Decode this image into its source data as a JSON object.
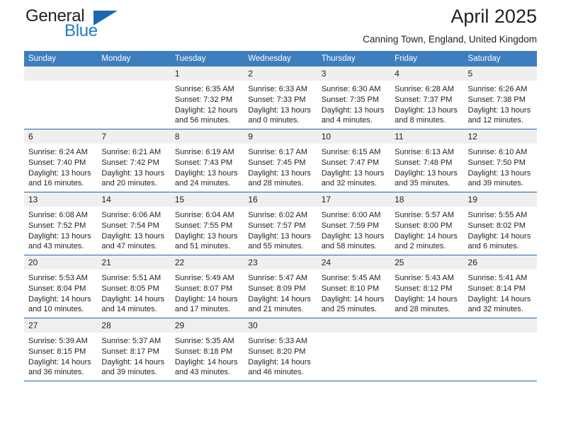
{
  "brand": {
    "name_part1": "General",
    "name_part2": "Blue",
    "triangle_icon": "triangle-icon",
    "color_primary": "#1b69b3",
    "color_text": "#231f20"
  },
  "header": {
    "month_title": "April 2025",
    "location": "Canning Town, England, United Kingdom"
  },
  "calendar": {
    "header_bg": "#3d7ebe",
    "daynum_bg": "#efefef",
    "row_border": "#1b69b3",
    "weekdays": [
      "Sunday",
      "Monday",
      "Tuesday",
      "Wednesday",
      "Thursday",
      "Friday",
      "Saturday"
    ],
    "weeks": [
      [
        {
          "day": "",
          "lines": []
        },
        {
          "day": "",
          "lines": []
        },
        {
          "day": "1",
          "lines": [
            "Sunrise: 6:35 AM",
            "Sunset: 7:32 PM",
            "Daylight: 12 hours",
            "and 56 minutes."
          ]
        },
        {
          "day": "2",
          "lines": [
            "Sunrise: 6:33 AM",
            "Sunset: 7:33 PM",
            "Daylight: 13 hours",
            "and 0 minutes."
          ]
        },
        {
          "day": "3",
          "lines": [
            "Sunrise: 6:30 AM",
            "Sunset: 7:35 PM",
            "Daylight: 13 hours",
            "and 4 minutes."
          ]
        },
        {
          "day": "4",
          "lines": [
            "Sunrise: 6:28 AM",
            "Sunset: 7:37 PM",
            "Daylight: 13 hours",
            "and 8 minutes."
          ]
        },
        {
          "day": "5",
          "lines": [
            "Sunrise: 6:26 AM",
            "Sunset: 7:38 PM",
            "Daylight: 13 hours",
            "and 12 minutes."
          ]
        }
      ],
      [
        {
          "day": "6",
          "lines": [
            "Sunrise: 6:24 AM",
            "Sunset: 7:40 PM",
            "Daylight: 13 hours",
            "and 16 minutes."
          ]
        },
        {
          "day": "7",
          "lines": [
            "Sunrise: 6:21 AM",
            "Sunset: 7:42 PM",
            "Daylight: 13 hours",
            "and 20 minutes."
          ]
        },
        {
          "day": "8",
          "lines": [
            "Sunrise: 6:19 AM",
            "Sunset: 7:43 PM",
            "Daylight: 13 hours",
            "and 24 minutes."
          ]
        },
        {
          "day": "9",
          "lines": [
            "Sunrise: 6:17 AM",
            "Sunset: 7:45 PM",
            "Daylight: 13 hours",
            "and 28 minutes."
          ]
        },
        {
          "day": "10",
          "lines": [
            "Sunrise: 6:15 AM",
            "Sunset: 7:47 PM",
            "Daylight: 13 hours",
            "and 32 minutes."
          ]
        },
        {
          "day": "11",
          "lines": [
            "Sunrise: 6:13 AM",
            "Sunset: 7:48 PM",
            "Daylight: 13 hours",
            "and 35 minutes."
          ]
        },
        {
          "day": "12",
          "lines": [
            "Sunrise: 6:10 AM",
            "Sunset: 7:50 PM",
            "Daylight: 13 hours",
            "and 39 minutes."
          ]
        }
      ],
      [
        {
          "day": "13",
          "lines": [
            "Sunrise: 6:08 AM",
            "Sunset: 7:52 PM",
            "Daylight: 13 hours",
            "and 43 minutes."
          ]
        },
        {
          "day": "14",
          "lines": [
            "Sunrise: 6:06 AM",
            "Sunset: 7:54 PM",
            "Daylight: 13 hours",
            "and 47 minutes."
          ]
        },
        {
          "day": "15",
          "lines": [
            "Sunrise: 6:04 AM",
            "Sunset: 7:55 PM",
            "Daylight: 13 hours",
            "and 51 minutes."
          ]
        },
        {
          "day": "16",
          "lines": [
            "Sunrise: 6:02 AM",
            "Sunset: 7:57 PM",
            "Daylight: 13 hours",
            "and 55 minutes."
          ]
        },
        {
          "day": "17",
          "lines": [
            "Sunrise: 6:00 AM",
            "Sunset: 7:59 PM",
            "Daylight: 13 hours",
            "and 58 minutes."
          ]
        },
        {
          "day": "18",
          "lines": [
            "Sunrise: 5:57 AM",
            "Sunset: 8:00 PM",
            "Daylight: 14 hours",
            "and 2 minutes."
          ]
        },
        {
          "day": "19",
          "lines": [
            "Sunrise: 5:55 AM",
            "Sunset: 8:02 PM",
            "Daylight: 14 hours",
            "and 6 minutes."
          ]
        }
      ],
      [
        {
          "day": "20",
          "lines": [
            "Sunrise: 5:53 AM",
            "Sunset: 8:04 PM",
            "Daylight: 14 hours",
            "and 10 minutes."
          ]
        },
        {
          "day": "21",
          "lines": [
            "Sunrise: 5:51 AM",
            "Sunset: 8:05 PM",
            "Daylight: 14 hours",
            "and 14 minutes."
          ]
        },
        {
          "day": "22",
          "lines": [
            "Sunrise: 5:49 AM",
            "Sunset: 8:07 PM",
            "Daylight: 14 hours",
            "and 17 minutes."
          ]
        },
        {
          "day": "23",
          "lines": [
            "Sunrise: 5:47 AM",
            "Sunset: 8:09 PM",
            "Daylight: 14 hours",
            "and 21 minutes."
          ]
        },
        {
          "day": "24",
          "lines": [
            "Sunrise: 5:45 AM",
            "Sunset: 8:10 PM",
            "Daylight: 14 hours",
            "and 25 minutes."
          ]
        },
        {
          "day": "25",
          "lines": [
            "Sunrise: 5:43 AM",
            "Sunset: 8:12 PM",
            "Daylight: 14 hours",
            "and 28 minutes."
          ]
        },
        {
          "day": "26",
          "lines": [
            "Sunrise: 5:41 AM",
            "Sunset: 8:14 PM",
            "Daylight: 14 hours",
            "and 32 minutes."
          ]
        }
      ],
      [
        {
          "day": "27",
          "lines": [
            "Sunrise: 5:39 AM",
            "Sunset: 8:15 PM",
            "Daylight: 14 hours",
            "and 36 minutes."
          ]
        },
        {
          "day": "28",
          "lines": [
            "Sunrise: 5:37 AM",
            "Sunset: 8:17 PM",
            "Daylight: 14 hours",
            "and 39 minutes."
          ]
        },
        {
          "day": "29",
          "lines": [
            "Sunrise: 5:35 AM",
            "Sunset: 8:18 PM",
            "Daylight: 14 hours",
            "and 43 minutes."
          ]
        },
        {
          "day": "30",
          "lines": [
            "Sunrise: 5:33 AM",
            "Sunset: 8:20 PM",
            "Daylight: 14 hours",
            "and 46 minutes."
          ]
        },
        {
          "day": "",
          "lines": []
        },
        {
          "day": "",
          "lines": []
        },
        {
          "day": "",
          "lines": []
        }
      ]
    ]
  }
}
